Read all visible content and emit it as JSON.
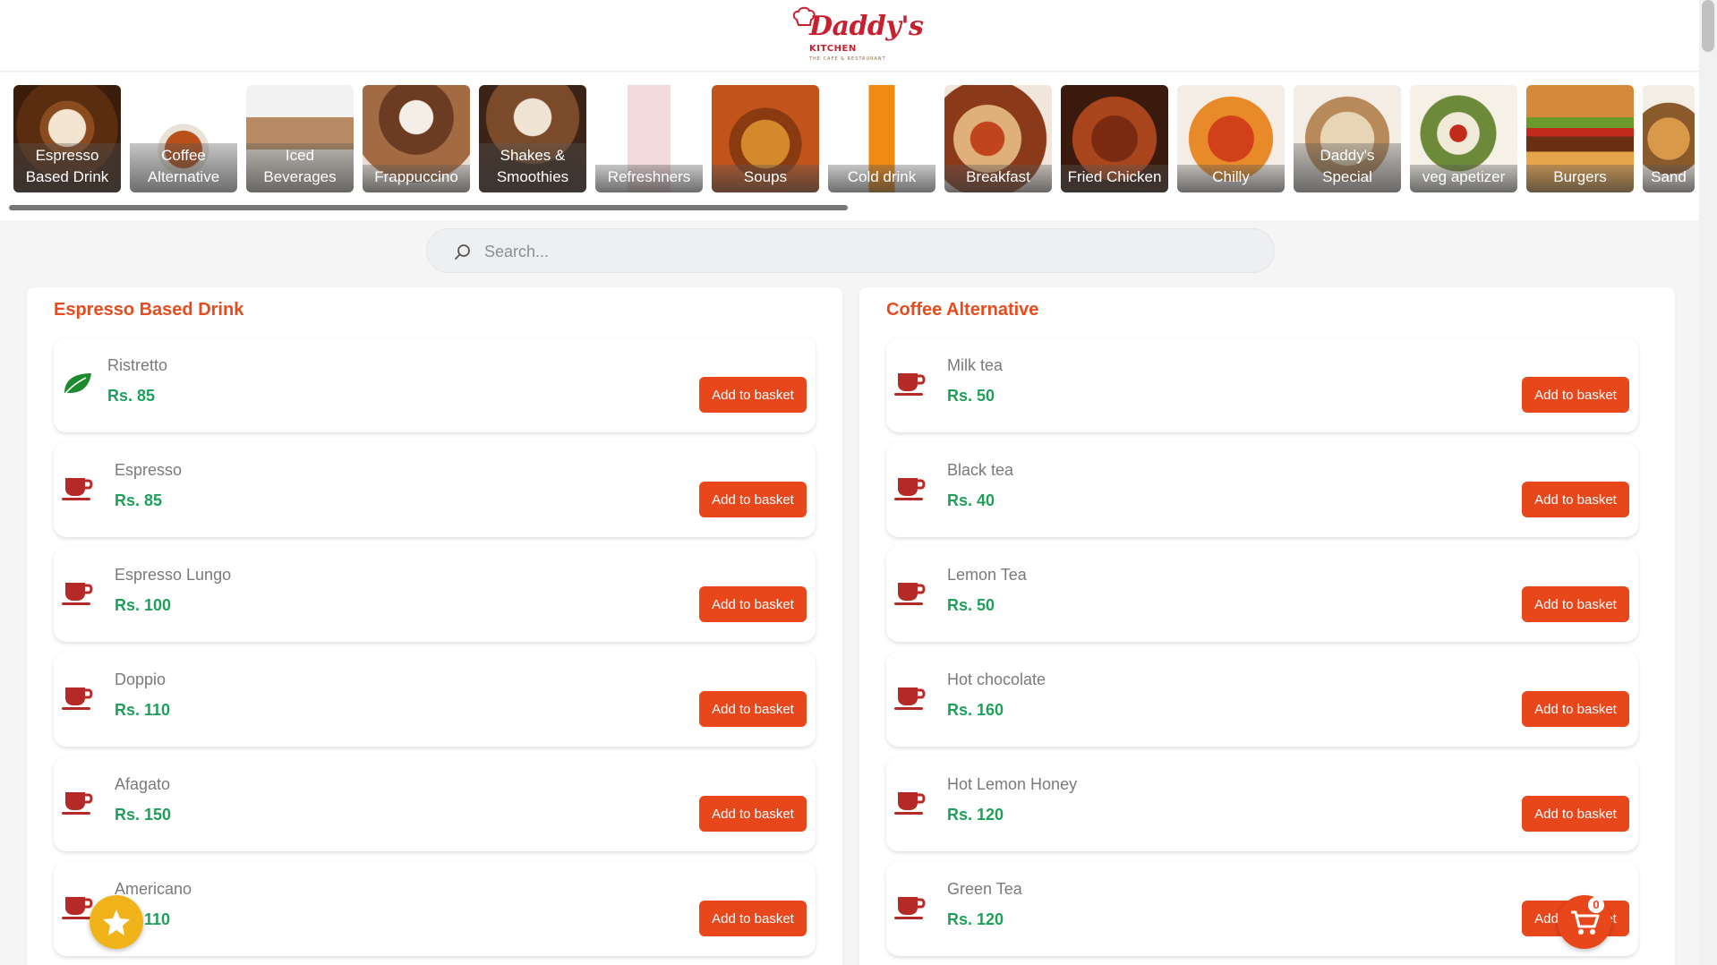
{
  "brand": {
    "name": "Daddy's",
    "sub": "KITCHEN",
    "tagline": "THE CAFE & RESTAURANT"
  },
  "categories": [
    {
      "label": "Espresso Based Drink",
      "icon": "latte-photo"
    },
    {
      "label": "Coffee Alternative",
      "icon": "tea-cup-photo"
    },
    {
      "label": "Iced Beverages",
      "icon": "iced-drink-photo"
    },
    {
      "label": "Frappuccino",
      "icon": "frappuccino-photo"
    },
    {
      "label": "Shakes & Smoothies",
      "icon": "shake-photo"
    },
    {
      "label": "Refreshners",
      "icon": "milkshake-photo"
    },
    {
      "label": "Soups",
      "icon": "soup-photo"
    },
    {
      "label": "Cold drink",
      "icon": "fanta-bottle-photo"
    },
    {
      "label": "Breakfast",
      "icon": "fried-rice-photo"
    },
    {
      "label": "Fried Chicken",
      "icon": "chicken-wings-photo"
    },
    {
      "label": "Chilly",
      "icon": "chilly-photo"
    },
    {
      "label": "Daddy's Special",
      "icon": "special-dish-photo"
    },
    {
      "label": "veg apetizer",
      "icon": "salad-photo"
    },
    {
      "label": "Burgers",
      "icon": "burger-photo"
    },
    {
      "label": "Sand",
      "icon": "sandwich-photo"
    }
  ],
  "search": {
    "placeholder": "Search..."
  },
  "sections": [
    {
      "title": "Espresso Based Drink",
      "items": [
        {
          "name": "Ristretto",
          "price": "Rs. 85",
          "icon": "leaf-icon"
        },
        {
          "name": "Espresso",
          "price": "Rs. 85",
          "icon": "coffee-cup-icon"
        },
        {
          "name": "Espresso Lungo",
          "price": "Rs. 100",
          "icon": "coffee-cup-icon"
        },
        {
          "name": "Doppio",
          "price": "Rs. 110",
          "icon": "coffee-cup-icon"
        },
        {
          "name": "Afagato",
          "price": "Rs. 150",
          "icon": "coffee-cup-icon"
        },
        {
          "name": "Americano",
          "price": "Rs. 110",
          "icon": "coffee-cup-icon"
        }
      ]
    },
    {
      "title": "Coffee Alternative",
      "items": [
        {
          "name": "Milk tea",
          "price": "Rs. 50",
          "icon": "coffee-cup-icon"
        },
        {
          "name": "Black tea",
          "price": "Rs. 40",
          "icon": "coffee-cup-icon"
        },
        {
          "name": "Lemon Tea",
          "price": "Rs. 50",
          "icon": "coffee-cup-icon"
        },
        {
          "name": "Hot chocolate",
          "price": "Rs. 160",
          "icon": "coffee-cup-icon"
        },
        {
          "name": "Hot Lemon Honey",
          "price": "Rs. 120",
          "icon": "coffee-cup-icon"
        },
        {
          "name": "Green Tea",
          "price": "Rs. 120",
          "icon": "coffee-cup-icon"
        }
      ]
    }
  ],
  "add_label": "Add to basket",
  "cart": {
    "count": "0",
    "icon": "cart-icon"
  },
  "favorites": {
    "icon": "star-icon"
  },
  "colors": {
    "accent": "#e8471c",
    "price": "#1fa05a",
    "title": "#e84c1e",
    "cup": "#b52a26",
    "leaf": "#1d8a2e",
    "star": "#f0b31a"
  }
}
